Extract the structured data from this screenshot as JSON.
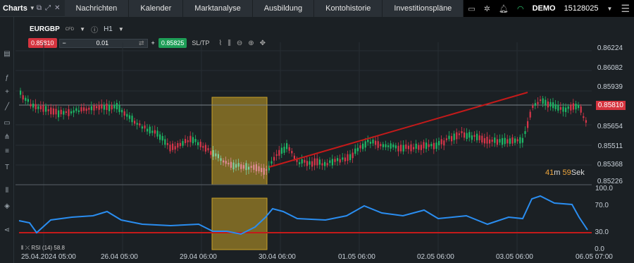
{
  "topbar": {
    "charts_label": "Charts",
    "tabs": [
      "Nachrichten",
      "Kalender",
      "Marktanalyse",
      "Ausbildung",
      "Kontohistorie",
      "Investitionspläne"
    ],
    "account_mode": "DEMO",
    "account_number": "15128025"
  },
  "symbol": {
    "name": "EURGBP",
    "type": "CFD",
    "timeframe": "H1"
  },
  "trade": {
    "sell_price": "0.85810",
    "lot": "0.01",
    "buy_price": "0.85825",
    "sltp_label": "SL/TP"
  },
  "timer": {
    "minutes": "41",
    "m_unit": "m",
    "seconds": "59",
    "s_unit": "Sek"
  },
  "rsi": {
    "label": "RSI (14) 58.8",
    "levels": [
      "100.0",
      "70.0",
      "30.0",
      "0.0"
    ]
  },
  "price_axis": [
    "0.86224",
    "0.86082",
    "0.85939",
    "0.85810",
    "0.85654",
    "0.85511",
    "0.85368",
    "0.85226"
  ],
  "current_price": "0.85810",
  "x_axis": [
    "25.04.2024 05:00",
    "26.04 05:00",
    "29.04 06:00",
    "30.04 06:00",
    "01.05 06:00",
    "02.05 06:00",
    "03.05 06:00",
    "06.05 07:00"
  ],
  "colors": {
    "bull": "#1eb866",
    "bear": "#d8364a",
    "rsi": "#2a8df0",
    "trend": "#c41a1a",
    "highlight": "#c9a227"
  }
}
